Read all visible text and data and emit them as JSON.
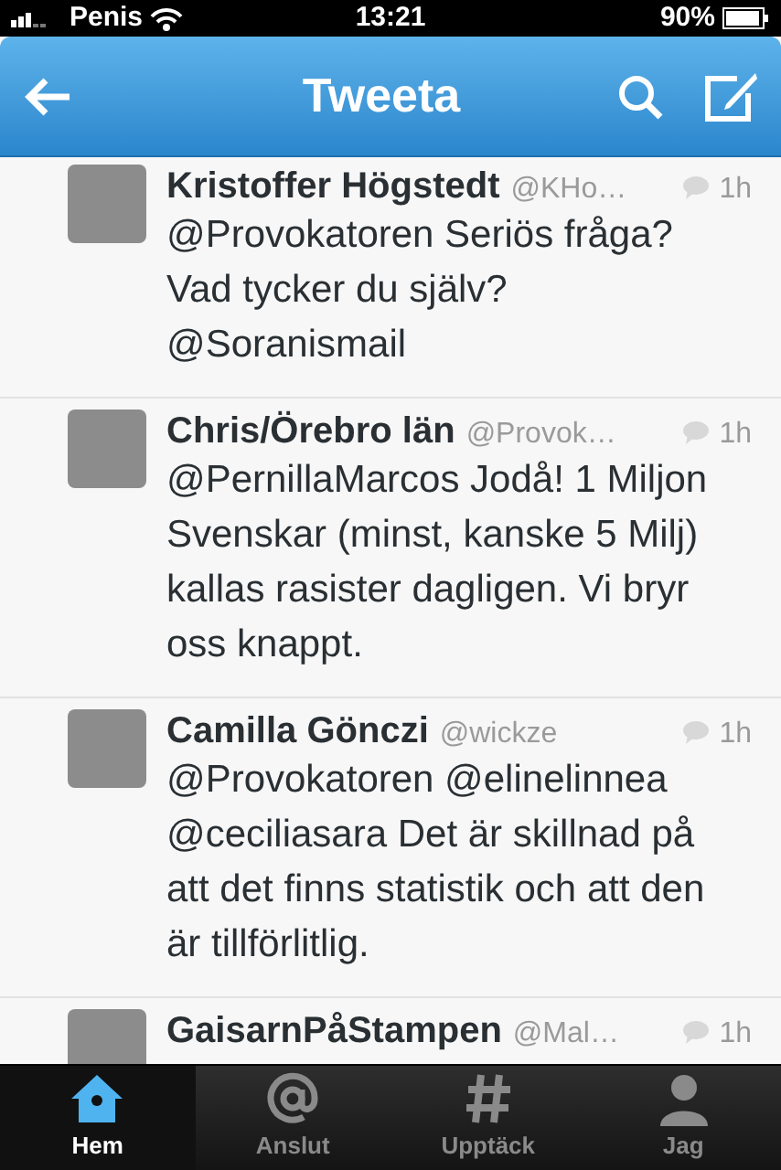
{
  "status_bar": {
    "carrier": "Penis",
    "time": "13:21",
    "battery": "90%"
  },
  "nav_bar": {
    "title": "Tweeta"
  },
  "tweets": [
    {
      "name": "Kristoffer Högstedt",
      "handle": "@KHo…",
      "time": "1h",
      "text": "@Provokatoren Seriös fråga? Vad tycker du själv? @Soranismail"
    },
    {
      "name": "Chris/Örebro län",
      "handle": "@Provok…",
      "time": "1h",
      "text": "@PernillaMarcos Jodå! 1 Miljon Svenskar (minst, kanske 5 Milj) kallas rasister dagligen. Vi bryr oss knappt."
    },
    {
      "name": "Camilla Gönczi",
      "handle": "@wickze",
      "time": "1h",
      "text": "@Provokatoren @elinelinnea @ceciliasara Det är skillnad på att det finns statistik och att den är tillförlitlig."
    },
    {
      "name": "GaisarnPåStampen",
      "handle": "@Mal…",
      "time": "1h"
    }
  ],
  "tab_bar": [
    {
      "kind": "home",
      "label": "Hem",
      "selected": true
    },
    {
      "kind": "connect",
      "label": "Anslut",
      "selected": false
    },
    {
      "kind": "discover",
      "label": "Upptäck",
      "selected": false
    },
    {
      "kind": "me",
      "label": "Jag",
      "selected": false
    }
  ]
}
